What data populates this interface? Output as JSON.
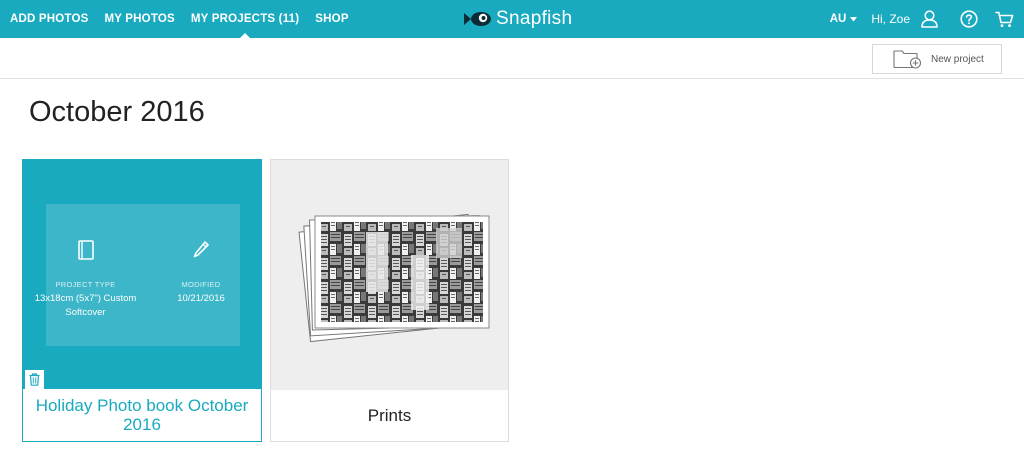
{
  "nav": {
    "items": [
      {
        "label": "ADD PHOTOS"
      },
      {
        "label": "MY PHOTOS"
      },
      {
        "label": "MY PROJECTS (11)"
      },
      {
        "label": "SHOP"
      }
    ],
    "active_index": 2,
    "logo": "Snapfish",
    "country": "AU",
    "greeting": "Hi, Zoe",
    "icons": [
      "fish-logo-icon",
      "chevron-down-icon",
      "user-icon",
      "help-icon",
      "cart-icon"
    ]
  },
  "toolbar": {
    "new_project_label": "New project",
    "new_project_icon": "folder-add-icon"
  },
  "page": {
    "title": "October 2016"
  },
  "projects": [
    {
      "name": "Holiday Photo book October 2016",
      "project_type_label": "PROJECT TYPE",
      "project_type_value": "13x18cm (5x7\") Custom Softcover",
      "modified_label": "MODIFIED",
      "modified_value": "10/21/2016",
      "icons": [
        "book-icon",
        "pencil-icon",
        "trash-icon"
      ]
    },
    {
      "name": "Prints",
      "thumbnail": "black-and-white city aerial photo prints"
    }
  ],
  "colors": {
    "brand": "#1aaabf",
    "text": "#222222",
    "card_bg": "#eeeeee"
  }
}
